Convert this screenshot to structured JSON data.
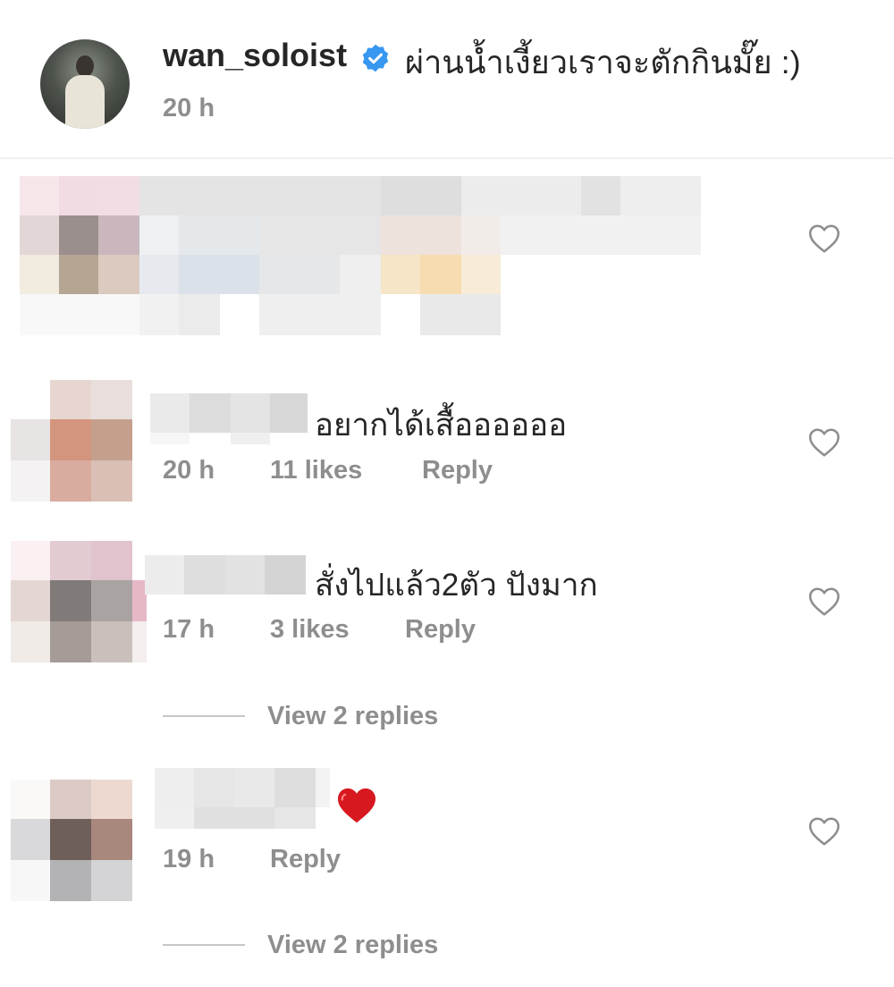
{
  "caption": {
    "username": "wan_soloist",
    "text": "ผ่านน้ำเงี้ยวเราจะตักกินมั๊ย :)",
    "time": "20 h"
  },
  "comments": [
    {
      "text": "",
      "blurred": true
    },
    {
      "text": "อยากได้เสื้ออออออ",
      "time": "20 h",
      "likes": "11 likes",
      "reply": "Reply"
    },
    {
      "text": "สั่งไปแล้ว2ตัว ปังมาก",
      "time": "17 h",
      "likes": "3 likes",
      "reply": "Reply",
      "view_replies": "View 2 replies"
    },
    {
      "text": "❤",
      "time": "19 h",
      "reply": "Reply",
      "view_replies": "View 2 replies"
    }
  ],
  "colors": {
    "meta_gray": "#8e8e8e",
    "verified_blue": "#3897f0",
    "heart_red": "#ed4956"
  },
  "icons": {
    "like": "heart-outline-icon",
    "verified": "verified-badge-icon"
  }
}
